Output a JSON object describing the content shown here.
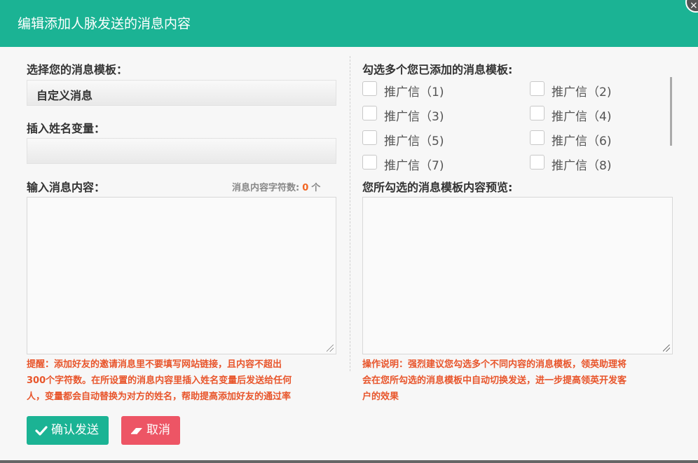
{
  "dialog": {
    "title": "编辑添加人脉发送的消息内容",
    "close_icon": "×"
  },
  "left": {
    "template_label": "选择您的消息模板：",
    "template_value": "自定义消息",
    "name_var_label": "插入姓名变量：",
    "name_var_value": "",
    "content_label": "输入消息内容：",
    "char_count_label": "消息内容字符数:",
    "char_count_value": "0",
    "char_count_unit": "个",
    "content_value": "",
    "reminder_lines": [
      "提醒：添加好友的邀请消息里不要填写网站链接，且内容不超出",
      "300个字符数。在所设置的消息内容里插入姓名变量后发送给任何",
      "人，变量都会自动替换为对方的姓名，帮助提高添加好友的通过率"
    ]
  },
  "right": {
    "multi_label": "勾选多个您已添加的消息模板:",
    "checkboxes": [
      {
        "label": "推广信（1)",
        "checked": false
      },
      {
        "label": "推广信（2)",
        "checked": false
      },
      {
        "label": "推广信（3)",
        "checked": false
      },
      {
        "label": "推广信（4)",
        "checked": false
      },
      {
        "label": "推广信（5)",
        "checked": false
      },
      {
        "label": "推广信（6)",
        "checked": false
      },
      {
        "label": "推广信（7)",
        "checked": false
      },
      {
        "label": "推广信（8)",
        "checked": false
      }
    ],
    "preview_label": "您所勾选的消息模板内容预览:",
    "preview_value": "",
    "instruction_lines": [
      "操作说明：强烈建议您勾选多个不同内容的消息模板，领英助理将",
      "会在您所勾选的消息模板中自动切换发送，进一步提高领英开发客",
      "户的效果"
    ]
  },
  "buttons": {
    "confirm_label": "确认发送",
    "confirm_icon": "check-icon",
    "cancel_label": "取消",
    "cancel_icon": "eraser-icon"
  },
  "colors": {
    "header_bg": "#1bb394",
    "confirm_bg": "#1bb394",
    "cancel_bg": "#ed5565",
    "note_text": "#e8552b",
    "count_highlight": "#f26522"
  }
}
